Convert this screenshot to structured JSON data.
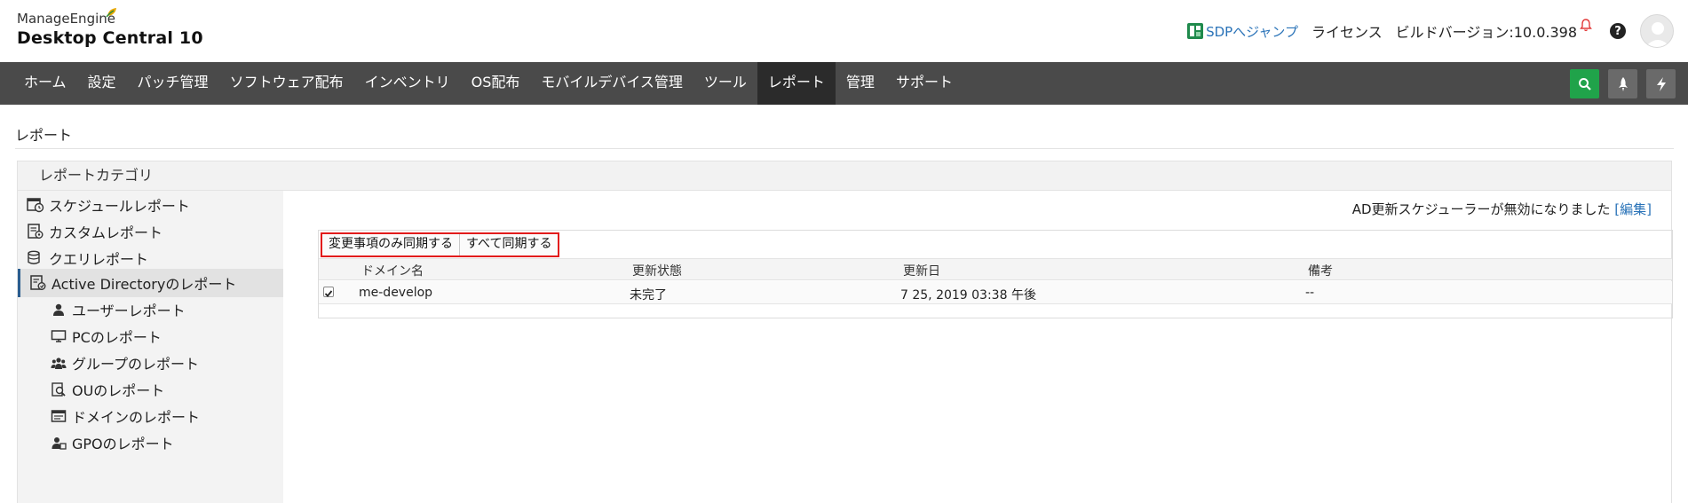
{
  "header": {
    "brand_small": "ManageEngine",
    "brand_product": "Desktop Central 10",
    "sdp_link": "SDPへジャンプ",
    "license": "ライセンス",
    "build_version": "ビルドバージョン:10.0.398",
    "help_glyph": "?"
  },
  "nav": {
    "items": [
      {
        "label": "ホーム"
      },
      {
        "label": "設定"
      },
      {
        "label": "パッチ管理"
      },
      {
        "label": "ソフトウェア配布"
      },
      {
        "label": "インベントリ"
      },
      {
        "label": "OS配布"
      },
      {
        "label": "モバイルデバイス管理"
      },
      {
        "label": "ツール"
      },
      {
        "label": "レポート",
        "active": true
      },
      {
        "label": "管理"
      },
      {
        "label": "サポート"
      }
    ],
    "accent_search": "#20a34a",
    "tools": [
      "search-icon",
      "rocket-icon",
      "lightning-icon"
    ]
  },
  "page": {
    "title": "レポート",
    "category_header": "レポートカテゴリ"
  },
  "sidebar": {
    "items": [
      {
        "label": "スケジュールレポート",
        "icon": "schedule-report-icon"
      },
      {
        "label": "カスタムレポート",
        "icon": "custom-report-icon"
      },
      {
        "label": "クエリレポート",
        "icon": "query-report-icon"
      },
      {
        "label": "Active Directoryのレポート",
        "icon": "ad-report-icon",
        "active": true
      },
      {
        "label": "ユーザーレポート",
        "icon": "user-icon",
        "sub": true
      },
      {
        "label": "PCのレポート",
        "icon": "monitor-icon",
        "sub": true
      },
      {
        "label": "グループのレポート",
        "icon": "group-icon",
        "sub": true
      },
      {
        "label": "OUのレポート",
        "icon": "ou-icon",
        "sub": true
      },
      {
        "label": "ドメインのレポート",
        "icon": "domain-icon",
        "sub": true
      },
      {
        "label": "GPOのレポート",
        "icon": "gpo-icon",
        "sub": true
      }
    ]
  },
  "content": {
    "status_text": "AD更新スケジューラーが無効になりました",
    "edit_link": "[編集]",
    "toolbar": {
      "sync_changes": "変更事項のみ同期する",
      "sync_all": "すべて同期する"
    },
    "columns": {
      "domain": "ドメイン名",
      "state": "更新状態",
      "date": "更新日",
      "note": "備考"
    },
    "rows": [
      {
        "checked": true,
        "domain": "me-develop",
        "state": "未完了",
        "date": "7 25, 2019 03:38 午後",
        "note": "--"
      }
    ]
  }
}
